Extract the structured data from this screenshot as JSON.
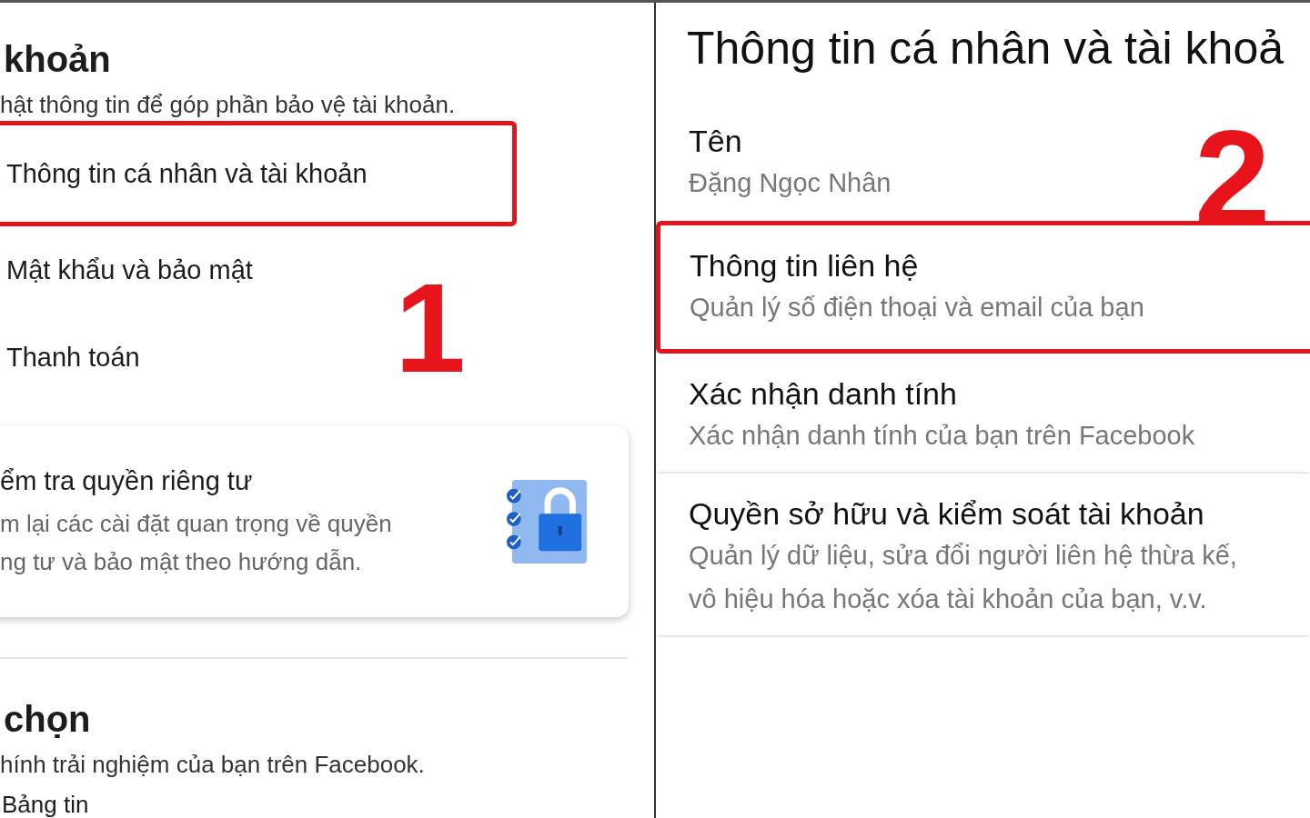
{
  "left_panel": {
    "section_title": "khoản",
    "section_subtitle": "hật thông tin để góp phần bảo vệ tài khoản.",
    "items": [
      {
        "label": "Thông tin cá nhân và tài khoản",
        "highlighted": true
      },
      {
        "label": "Mật khẩu và bảo mật",
        "highlighted": false
      },
      {
        "label": "Thanh toán",
        "highlighted": false
      }
    ],
    "step_number": "1",
    "privacy_card": {
      "title": "ểm tra quyền riêng tư",
      "description_lines": [
        "m lại các cài đặt quan trọng về quyền",
        "ng tư và bảo mật theo hướng dẫn."
      ]
    },
    "preferences": {
      "title": "chọn",
      "subtitle": "hính trải nghiệm của bạn trên Facebook.",
      "items": [
        {
          "label": "Bảng tin"
        }
      ]
    }
  },
  "right_panel": {
    "title": "Thông tin cá nhân và tài khoả",
    "step_number": "2",
    "items": [
      {
        "title": "Tên",
        "subtitle": "Đặng Ngọc Nhân",
        "highlighted": false
      },
      {
        "title": "Thông tin liên hệ",
        "subtitle": "Quản lý số điện thoại và email của bạn",
        "highlighted": true
      },
      {
        "title": "Xác nhận danh tính",
        "subtitle": "Xác nhận danh tính của bạn trên Facebook",
        "highlighted": false
      },
      {
        "title": "Quyền sở hữu và kiểm soát tài khoản",
        "subtitle": "Quản lý dữ liệu, sửa đổi người liên hệ thừa kế, vô hiệu hóa hoặc xóa tài khoản của bạn, v.v.",
        "highlighted": false
      }
    ]
  }
}
